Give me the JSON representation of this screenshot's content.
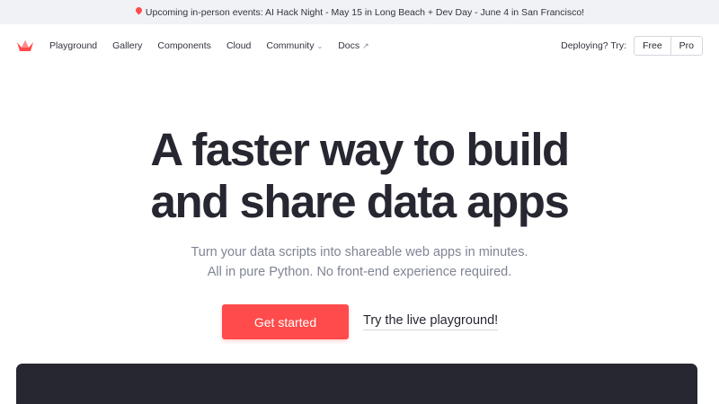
{
  "banner": {
    "icon": "location-pin-icon",
    "text": "Upcoming in-person events: AI Hack Night - May 15 in Long Beach + Dev Day - June 4 in San Francisco!"
  },
  "nav": {
    "logo": "streamlit-crown-logo",
    "links": [
      {
        "label": "Playground"
      },
      {
        "label": "Gallery"
      },
      {
        "label": "Components"
      },
      {
        "label": "Cloud"
      },
      {
        "label": "Community",
        "icon": "chevron-down-icon"
      },
      {
        "label": "Docs",
        "icon": "external-link-icon"
      }
    ],
    "deploying_label": "Deploying? Try:",
    "free_label": "Free",
    "pro_label": "Pro"
  },
  "hero": {
    "title_line1": "A faster way to build",
    "title_line2": "and share data apps",
    "subtitle_line1": "Turn your data scripts into shareable web apps in minutes.",
    "subtitle_line2": "All in pure Python. No front-end experience required.",
    "primary_cta": "Get started",
    "secondary_cta": "Try the live playground!"
  },
  "colors": {
    "accent": "#ff4b4b",
    "text_dark": "#262730",
    "banner_bg": "#f0f2f6",
    "subtitle": "#808495",
    "panel_bg": "#262730"
  }
}
